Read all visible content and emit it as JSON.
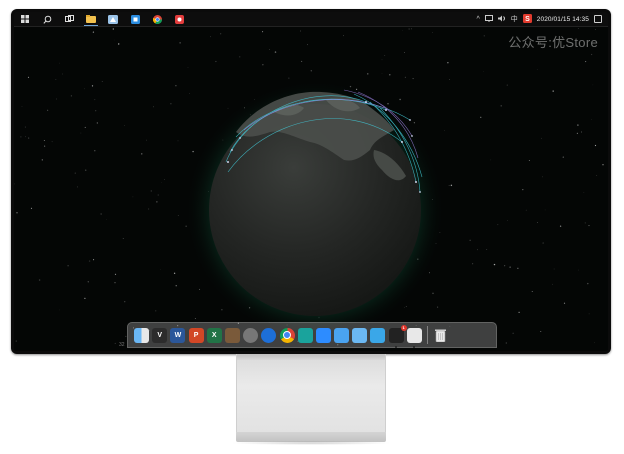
{
  "taskbar": {
    "start_icon": "windows-logo-icon",
    "search_icon": "search-icon",
    "taskview_icon": "task-view-icon",
    "pinned_apps": [
      {
        "name": "file-explorer",
        "icon": "folder-icon",
        "color": "#f2c14e"
      },
      {
        "name": "app-2",
        "icon": "generic-app-icon",
        "color": "#9bc3e8"
      },
      {
        "name": "app-3",
        "icon": "blue-app-icon",
        "color": "#2b8de0"
      },
      {
        "name": "chrome",
        "icon": "chrome-icon",
        "color": "#db4437"
      },
      {
        "name": "app-5",
        "icon": "red-app-icon",
        "color": "#e33d3d"
      }
    ],
    "tray_ime": "中",
    "clock": "2020/01/15 14:35"
  },
  "watermark": "公众号:优Store",
  "dock": {
    "corner_number": "32",
    "apps": [
      {
        "name": "finder",
        "icon": "finder-icon",
        "color": "#d9d9d9",
        "label": ""
      },
      {
        "name": "vectorworks",
        "icon": "v-logo-icon",
        "color": "#2c2c2c",
        "label": "V"
      },
      {
        "name": "word",
        "icon": "word-icon",
        "color": "#2b579a",
        "label": "W"
      },
      {
        "name": "powerpoint",
        "icon": "powerpoint-icon",
        "color": "#d24726",
        "label": "P"
      },
      {
        "name": "excel",
        "icon": "excel-icon",
        "color": "#217346",
        "label": "X"
      },
      {
        "name": "sketch-tool",
        "icon": "pen-tool-icon",
        "color": "#7a5a3a",
        "label": ""
      },
      {
        "name": "settings",
        "icon": "gear-icon",
        "color": "#777777",
        "label": ""
      },
      {
        "name": "browser-blue",
        "icon": "compass-icon",
        "color": "#1d6fd8",
        "label": ""
      },
      {
        "name": "chrome",
        "icon": "chrome-icon",
        "color": "#ffffff",
        "label": ""
      },
      {
        "name": "app-teal",
        "icon": "teal-app-icon",
        "color": "#1aa39c",
        "label": ""
      },
      {
        "name": "zoom",
        "icon": "video-camera-icon",
        "color": "#2d8cff",
        "label": ""
      },
      {
        "name": "messages",
        "icon": "chat-bubble-icon",
        "color": "#4aa3f0",
        "label": ""
      },
      {
        "name": "mail",
        "icon": "envelope-icon",
        "color": "#6bb8f2",
        "label": ""
      },
      {
        "name": "qq",
        "icon": "penguin-icon",
        "color": "#3aa7e8",
        "label": ""
      },
      {
        "name": "terminal",
        "icon": "terminal-icon",
        "color": "#222222",
        "label": "",
        "badge": "1"
      },
      {
        "name": "app-sign",
        "icon": "sign-icon",
        "color": "#e8e8e8",
        "label": ""
      }
    ],
    "trash_icon": "trash-icon"
  }
}
